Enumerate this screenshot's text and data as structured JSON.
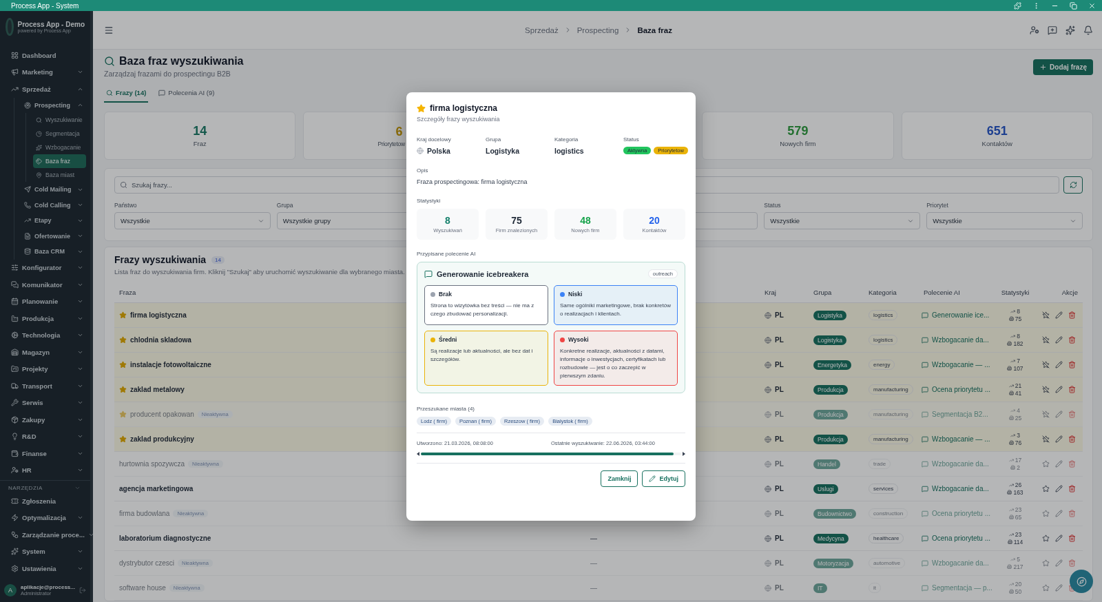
{
  "titlebar": {
    "title": "Process App - System"
  },
  "brand": {
    "name": "Process App - Demo",
    "tagline": "powered by Process App"
  },
  "nav": [
    {
      "label": "Dashboard",
      "selected": false
    },
    {
      "label": "Marketing",
      "selected": false,
      "expanded": false
    },
    {
      "label": "Sprzedaż",
      "selected": false,
      "expanded": true,
      "children": [
        {
          "label": "Prospecting",
          "selected": false,
          "expanded": true,
          "children": [
            {
              "label": "Wyszukiwanie",
              "selected": false
            },
            {
              "label": "Segmentacja",
              "selected": false
            },
            {
              "label": "Wzbogacanie",
              "selected": false
            },
            {
              "label": "Baza fraz",
              "selected": true
            },
            {
              "label": "Baza miast",
              "selected": false
            }
          ]
        },
        {
          "label": "Cold Mailing",
          "selected": false,
          "expanded": false
        },
        {
          "label": "Cold Calling",
          "selected": false,
          "expanded": false
        },
        {
          "label": "Etapy",
          "selected": false,
          "expanded": false
        },
        {
          "label": "Ofertowanie",
          "selected": false,
          "expanded": false
        },
        {
          "label": "Baza CRM",
          "selected": false,
          "expanded": false
        }
      ]
    },
    {
      "label": "Konfigurator",
      "selected": false,
      "expanded": false
    },
    {
      "label": "Komunikator",
      "selected": false,
      "expanded": false
    },
    {
      "label": "Planowanie",
      "selected": false,
      "expanded": false
    },
    {
      "label": "Produkcja",
      "selected": false,
      "expanded": false
    },
    {
      "label": "Technologia",
      "selected": false,
      "expanded": false
    },
    {
      "label": "Magazyn",
      "selected": false,
      "expanded": false
    },
    {
      "label": "Projekty",
      "selected": false,
      "expanded": false
    },
    {
      "label": "Transport",
      "selected": false,
      "expanded": false
    },
    {
      "label": "Serwis",
      "selected": false,
      "expanded": false
    },
    {
      "label": "Zakupy",
      "selected": false,
      "expanded": false
    },
    {
      "label": "R&D",
      "selected": false,
      "expanded": false
    },
    {
      "label": "Finanse",
      "selected": false,
      "expanded": false
    },
    {
      "label": "HR",
      "selected": false,
      "expanded": false
    }
  ],
  "tools": {
    "label": "NARZĘDZIA",
    "items": [
      {
        "label": "Zgłoszenia",
        "selected": false
      },
      {
        "label": "Optymalizacja",
        "selected": false,
        "expanded": false
      },
      {
        "label": "Zarządzanie proce...",
        "selected": false,
        "expanded": false
      },
      {
        "label": "System",
        "selected": false,
        "expanded": false
      },
      {
        "label": "Ustawienia",
        "selected": false,
        "expanded": false
      }
    ]
  },
  "user": {
    "initial": "A",
    "email": "aplikacje@process...",
    "role": "Administrator"
  },
  "breadcrumb": [
    "Sprzedaż",
    "Prospecting",
    "Baza fraz"
  ],
  "page": {
    "title": "Baza fraz wyszukiwania",
    "subtitle": "Zarządzaj frazami do prospectingu B2B",
    "add_button": "Dodaj frazę"
  },
  "tabs": [
    {
      "label": "Frazy (14)",
      "selected": true
    },
    {
      "label": "Polecenia AI (9)",
      "selected": false
    }
  ],
  "stats": [
    {
      "value": "14",
      "label": "Fraz"
    },
    {
      "value": "6",
      "label": "Priorytetow"
    },
    {
      "value": "579",
      "label": "Nowych firm"
    },
    {
      "value": "651",
      "label": "Kontaktów"
    }
  ],
  "filters": {
    "search_placeholder": "Szukaj frazy...",
    "selects": [
      {
        "label": "Państwo",
        "value": "Wszystkie"
      },
      {
        "label": "Grupa",
        "value": "Wszystkie grupy"
      },
      {
        "label": "Status",
        "value": "Wszystkie"
      },
      {
        "label": "Priorytet",
        "value": "Wszystkie"
      }
    ]
  },
  "table": {
    "title": "Frazy wyszukiwania",
    "count": "14",
    "description": "Lista fraz do wyszukiwania firm. Kliknij \"Szukaj\" aby uruchomić wyszukiwanie dla wybranego miasta.",
    "columns": [
      "Fraza",
      "Kraj",
      "Grupa",
      "Kategoria",
      "Polecenie AI",
      "Statystyki",
      "Akcje"
    ],
    "rows": [
      {
        "phrase": "firma logistyczna",
        "priority": true,
        "active": true,
        "country": "PL",
        "group": "Logistyka",
        "category": "logistics",
        "prompt": "Generowanie ice...",
        "searches": "8",
        "firms": "75"
      },
      {
        "phrase": "chlodnia skladowa",
        "priority": true,
        "active": true,
        "country": "PL",
        "group": "Logistyka",
        "category": "logistics",
        "prompt": "Wzbogacanie da...",
        "searches": "8",
        "firms": "182"
      },
      {
        "phrase": "instalacje fotowoltaiczne",
        "priority": true,
        "active": true,
        "country": "PL",
        "group": "Energetyka",
        "category": "energy",
        "prompt": "Wzbogacanie — ...",
        "searches": "7",
        "firms": "107"
      },
      {
        "phrase": "zaklad metalowy",
        "priority": true,
        "active": true,
        "country": "PL",
        "group": "Produkcja",
        "category": "manufacturing",
        "prompt": "Ocena priorytetu ...",
        "searches": "21",
        "firms": "41"
      },
      {
        "phrase": "producent opakowan",
        "priority": true,
        "active": false,
        "status_badge": "Nieaktywna",
        "country": "PL",
        "group": "Produkcja",
        "category": "manufacturing",
        "prompt": "Segmentacja B2...",
        "searches": "4",
        "firms": "25"
      },
      {
        "phrase": "zaklad produkcyjny",
        "priority": true,
        "active": true,
        "country": "PL",
        "group": "Produkcja",
        "category": "manufacturing",
        "prompt": "Wzbogacanie — ...",
        "searches": "3",
        "firms": "76"
      },
      {
        "phrase": "hurtownia spozywcza",
        "priority": false,
        "active": false,
        "status_badge": "Nieaktywna",
        "country": "PL",
        "group": "Handel",
        "category": "trade",
        "prompt": "Wzbogacanie da...",
        "searches": "17",
        "firms": "2"
      },
      {
        "phrase": "agencja marketingowa",
        "priority": false,
        "active": true,
        "country": "PL",
        "group": "Uslugi",
        "category": "services",
        "prompt": "Wzbogacanie da...",
        "searches": "26",
        "firms": "163"
      },
      {
        "phrase": "firma budowlana",
        "priority": false,
        "active": false,
        "status_badge": "Nieaktywna",
        "country": "PL",
        "group": "Budownictwo",
        "category": "construction",
        "prompt": "Ocena priorytetu ...",
        "searches": "23",
        "firms": "65"
      },
      {
        "phrase": "laboratorium diagnostyczne",
        "priority": false,
        "active": true,
        "column_2": "—",
        "country": "PL",
        "group": "Medycyna",
        "category": "healthcare",
        "prompt": "Ocena priorytetu ...",
        "searches": "23",
        "firms": "114"
      },
      {
        "phrase": "dystrybutor czesci",
        "priority": false,
        "active": false,
        "status_badge": "Nieaktywna",
        "column_2": "—",
        "country": "PL",
        "group": "Motoryzacja",
        "category": "automotive",
        "prompt": "Wzbogacanie da...",
        "searches": "5",
        "firms": "217"
      },
      {
        "phrase": "software house",
        "priority": false,
        "active": false,
        "status_badge": "Nieaktywna",
        "column_2": "—",
        "country": "PL",
        "group": "IT",
        "category": "it",
        "prompt": "Segmentacja — p...",
        "searches": "20",
        "firms": "50"
      }
    ]
  },
  "modal": {
    "title": "firma logistyczna",
    "priority": true,
    "subtitle": "Szczegóły frazy wyszukiwania",
    "fields": [
      {
        "label": "Kraj docelowy",
        "kind": "country",
        "value": "Polska"
      },
      {
        "label": "Grupa",
        "kind": "text",
        "value": "Logistyka"
      },
      {
        "label": "Kategoria",
        "kind": "text",
        "value": "logistics"
      },
      {
        "label": "Status",
        "kind": "badges",
        "badges": [
          {
            "text": "Aktywna",
            "color": "#22c55e"
          },
          {
            "text": "Priorytetow",
            "color": "#eab308"
          }
        ]
      }
    ],
    "description_label": "Opis",
    "description": "Fraza prospectingowa: firma logistyczna",
    "stats_label": "Statystyki",
    "stats": [
      {
        "value": "8",
        "label": "Wyszukiwań",
        "color": "#14806b"
      },
      {
        "value": "75",
        "label": "Firm znalezionych",
        "color": "#1f2937"
      },
      {
        "value": "48",
        "label": "Nowych firm",
        "color": "#16a34a"
      },
      {
        "value": "20",
        "label": "Kontaktów",
        "color": "#2563eb"
      }
    ],
    "prompt_label": "Przypisane polecenie AI",
    "prompt": {
      "name": "Generowanie icebreakera",
      "tag": "outreach",
      "levels": [
        {
          "name": "Brak",
          "color": "#9ca3af",
          "text": "Strona to wizytówka bez treści — nie ma z czego zbudować personalizacji."
        },
        {
          "name": "Niski",
          "color": "#3b82f6",
          "text": "Same ogólniki marketingowe, brak konkretów o realizacjach i klientach."
        },
        {
          "name": "Średni",
          "color": "#eab308",
          "text": "Są realizacje lub aktualności, ale bez dat i szczegółów."
        },
        {
          "name": "Wysoki",
          "color": "#ef4444",
          "text": "Konkretne realizacje, aktualności z datami, informacje o inwestycjach, certyfikatach lub rozbudowie — jest o co zaczepić w pierwszym zdaniu."
        }
      ]
    },
    "cities_label": "Przeszukane miasta (4)",
    "cities": [
      "Lodz ( firm)",
      "Poznan ( firm)",
      "Rzeszow ( firm)",
      "Bialystok ( firm)"
    ],
    "created": "Utworzono: 21.03.2026, 08:08:00",
    "last_search": "Ostatnie wyszukiwanie: 22.06.2026, 03:44:00",
    "buttons": [
      {
        "label": "Zamknij",
        "kind": "close"
      },
      {
        "label": "Edytuj",
        "kind": "edit"
      }
    ]
  }
}
